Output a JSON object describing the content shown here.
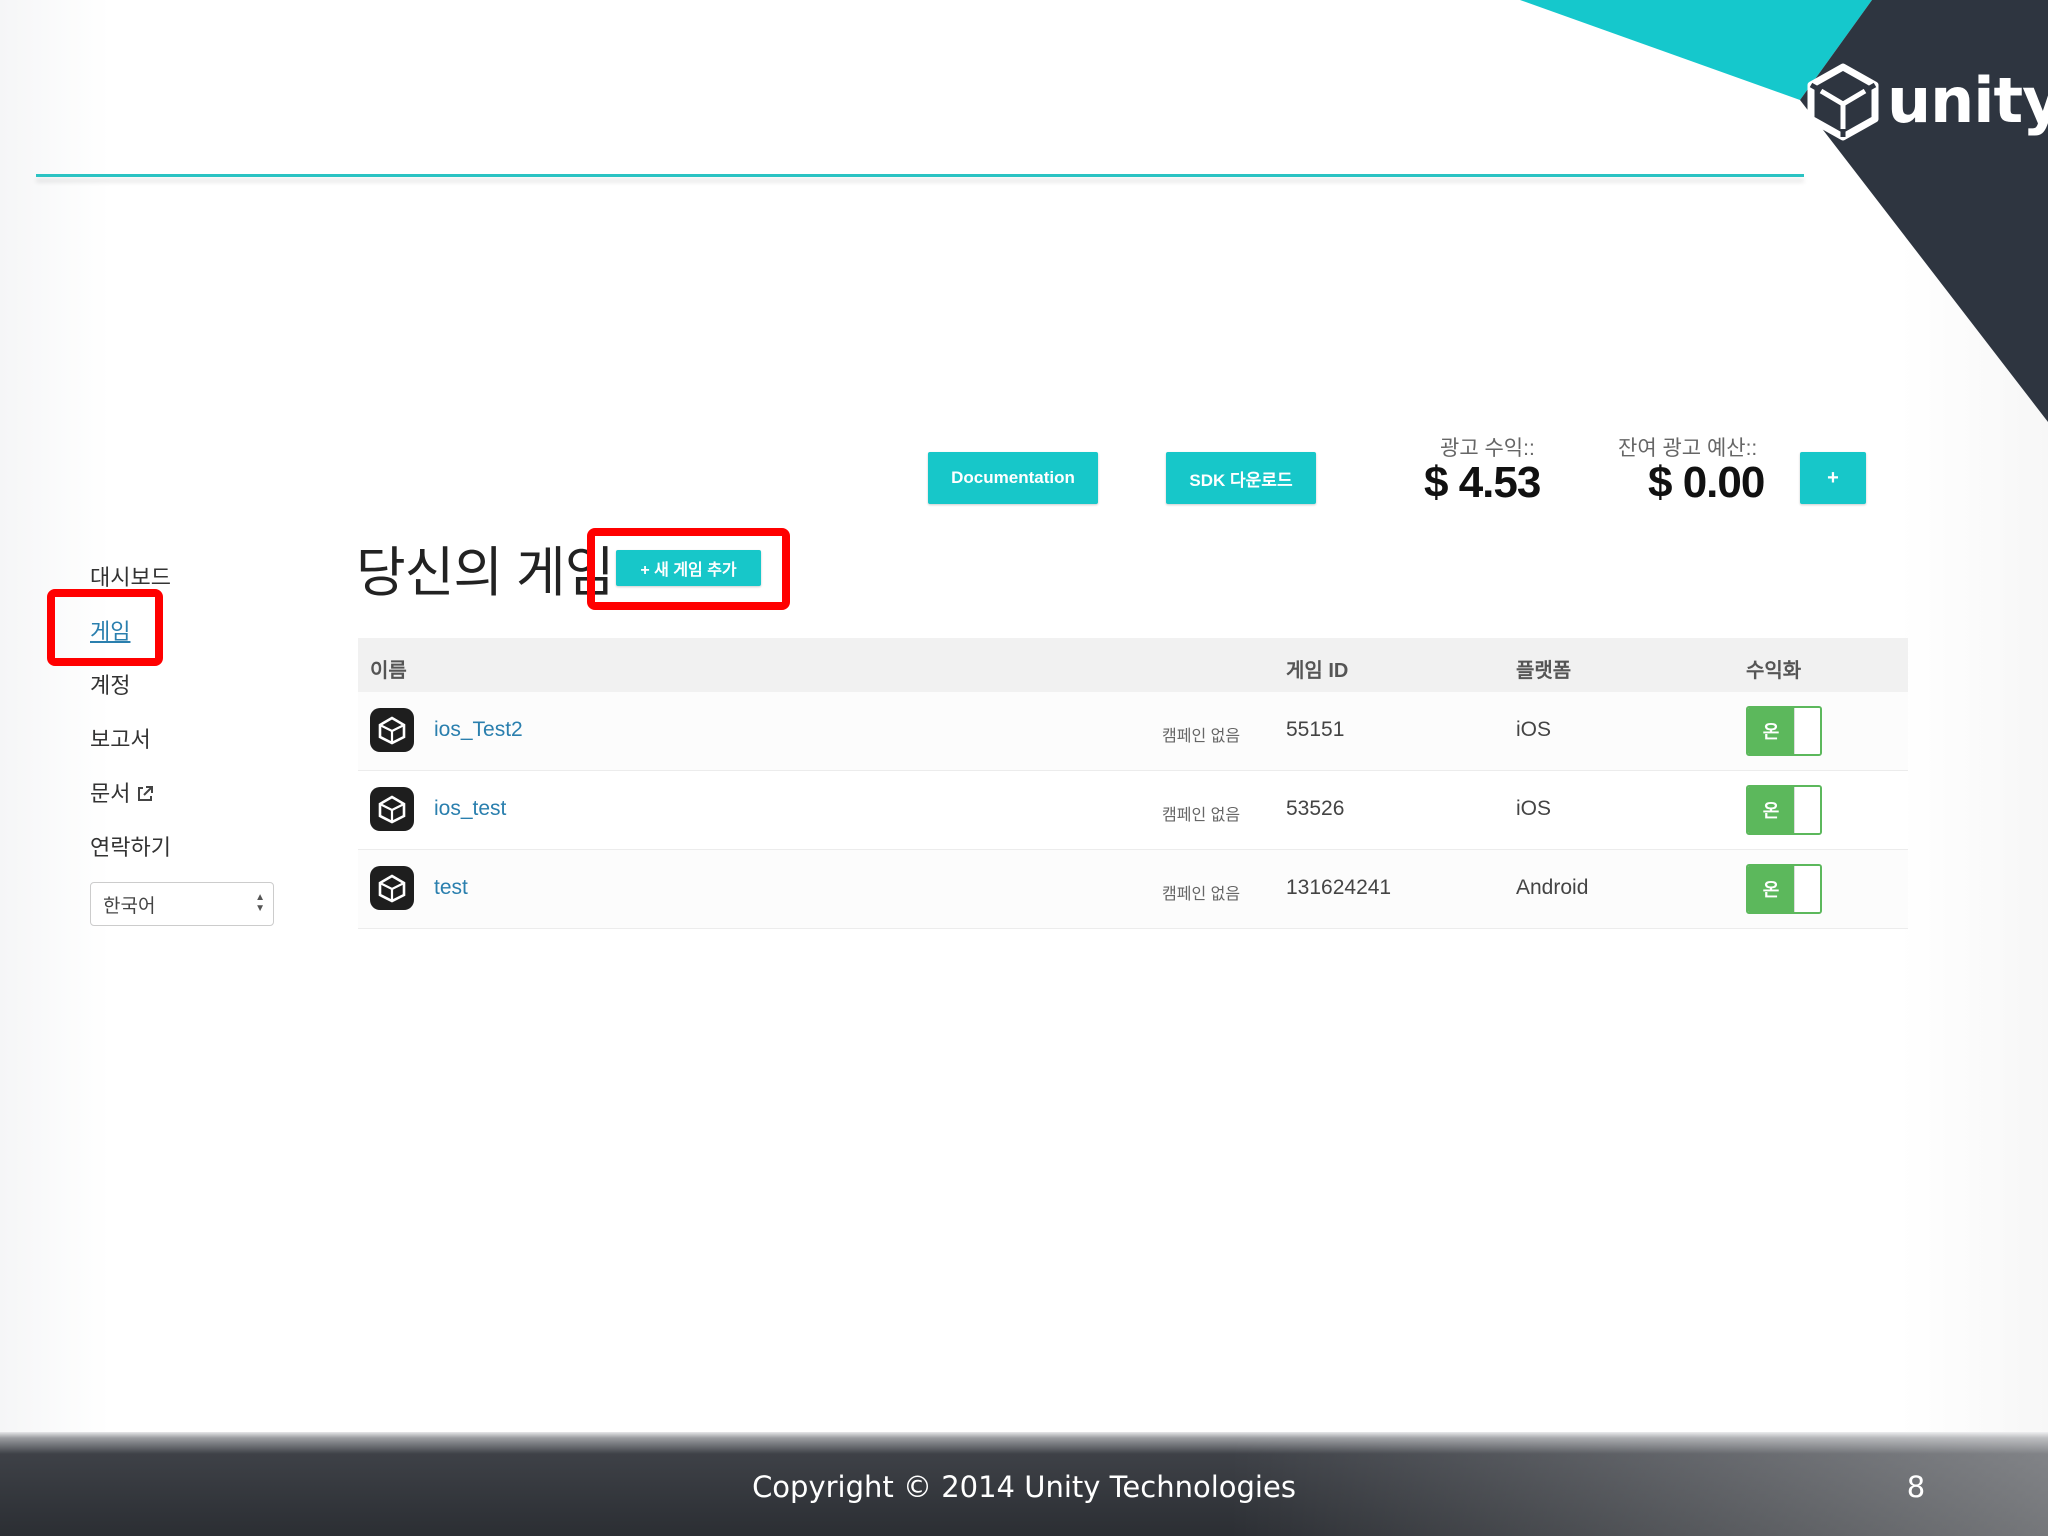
{
  "brand": {
    "logo_text": "unity",
    "accent_color": "#17c7c9",
    "dark_color": "#2e3540",
    "link_color": "#2a7fae",
    "toggle_color": "#5cb85c",
    "highlight_color": "#ff0000"
  },
  "toolbar": {
    "documentation_label": "Documentation",
    "sdk_label": "SDK 다운로드",
    "ad_revenue_label": "광고 수익::",
    "ad_revenue_value": "$ 4.53",
    "remaining_budget_label": "잔여 광고 예산::",
    "remaining_budget_value": "$ 0.00",
    "add_budget_label": "+"
  },
  "sidebar": {
    "items": [
      {
        "label": "대시보드"
      },
      {
        "label": "게임"
      },
      {
        "label": "계정"
      },
      {
        "label": "보고서"
      },
      {
        "label": "문서",
        "icon": "external-link-icon"
      },
      {
        "label": "연락하기"
      }
    ],
    "active_item": "게임",
    "language_select": {
      "selected": "한국어"
    }
  },
  "main": {
    "title": "당신의 게임",
    "add_game_label": "+ 새 게임 추가",
    "table": {
      "columns": {
        "name": "이름",
        "game_id": "게임 ID",
        "platform": "플랫폼",
        "monetization": "수익화"
      },
      "rows": [
        {
          "name": "ios_Test2",
          "campaign": "캠페인 없음",
          "game_id": "55151",
          "platform": "iOS",
          "monetization": "온"
        },
        {
          "name": "ios_test",
          "campaign": "캠페인 없음",
          "game_id": "53526",
          "platform": "iOS",
          "monetization": "온"
        },
        {
          "name": "test",
          "campaign": "캠페인 없음",
          "game_id": "131624241",
          "platform": "Android",
          "monetization": "온"
        }
      ]
    }
  },
  "footer": {
    "copyright": "Copyright © 2014 Unity Technologies",
    "page_number": "8"
  }
}
